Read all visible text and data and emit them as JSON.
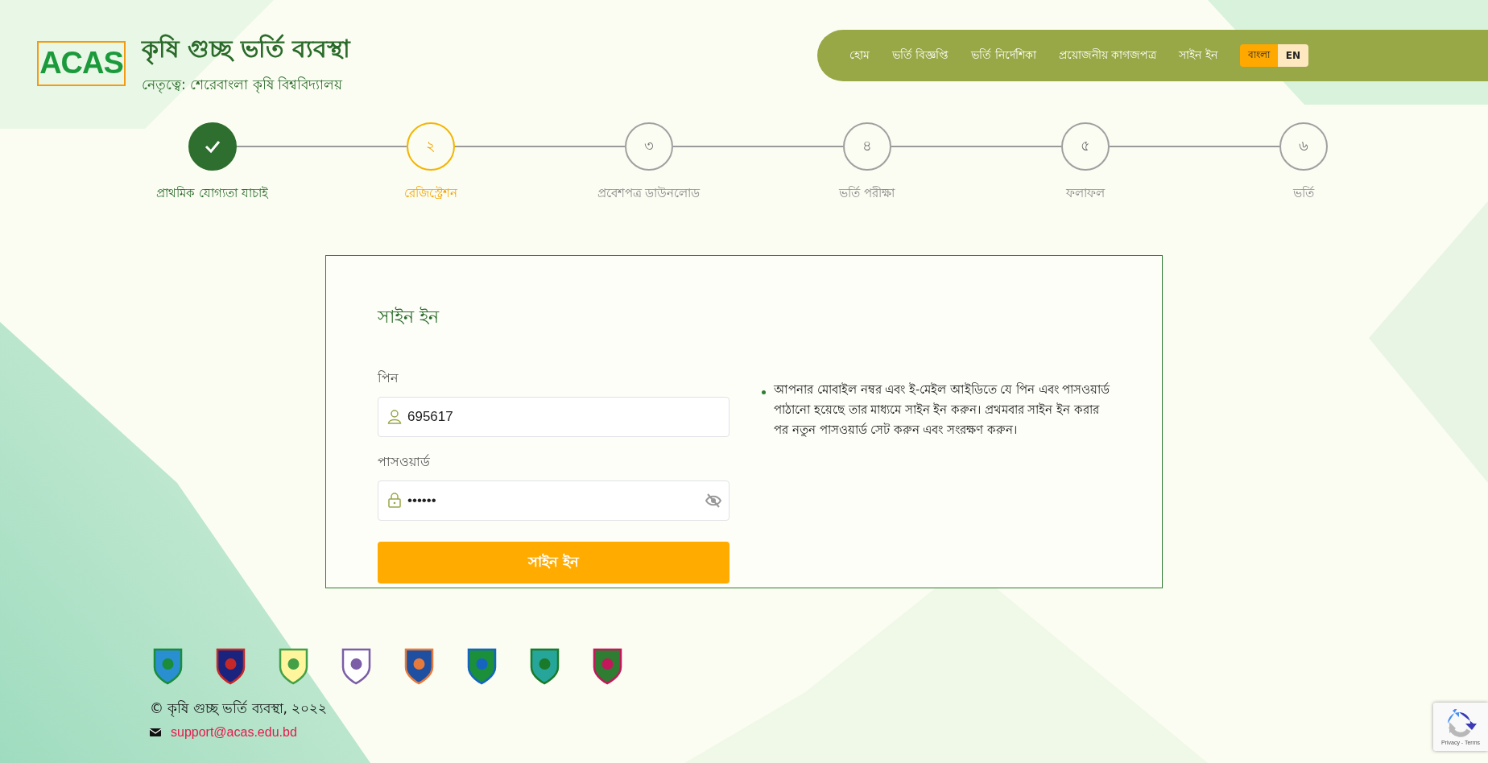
{
  "header": {
    "logo_text": "ACAS",
    "title": "কৃষি গুচ্ছ ভর্তি ব্যবস্থা",
    "subtitle": "নেতৃত্বে: শেরেবাংলা কৃষি বিশ্ববিদ্যালয়"
  },
  "nav": {
    "items": [
      {
        "label": "হোম"
      },
      {
        "label": "ভর্তি বিজ্ঞপ্তি"
      },
      {
        "label": "ভর্তি নির্দেশিকা"
      },
      {
        "label": "প্রয়োজনীয় কাগজপত্র"
      },
      {
        "label": "সাইন ইন"
      }
    ],
    "languages": [
      {
        "label": "বাংলা",
        "selected": true
      },
      {
        "label": "EN",
        "selected": false
      }
    ]
  },
  "steps": [
    {
      "label": "প্রাথমিক যোগ্যতা যাচাই",
      "kind": "done"
    },
    {
      "number": "২",
      "label": "রেজিস্ট্রেশন",
      "kind": "current"
    },
    {
      "number": "৩",
      "label": "প্রবেশপত্র ডাউনলোড",
      "kind": "pending"
    },
    {
      "number": "৪",
      "label": "ভর্তি পরীক্ষা",
      "kind": "pending"
    },
    {
      "number": "৫",
      "label": "ফলাফল",
      "kind": "pending"
    },
    {
      "number": "৬",
      "label": "ভর্তি",
      "kind": "pending"
    }
  ],
  "form": {
    "title": "সাইন ইন",
    "fields": [
      {
        "label": "পিন",
        "value": "695617",
        "kind": "user"
      },
      {
        "label": "পাসওয়ার্ড",
        "value": "••••••",
        "kind": "password"
      }
    ],
    "submit": "সাইন ইন",
    "note": "আপনার মোবাইল নম্বর এবং ই-মেইল আইডিতে যে পিন এবং পাসওয়ার্ড পাঠানো হয়েছে তার মাধ্যমে সাইন ইন করুন। প্রথমবার সাইন ইন করার পর নতুন পাসওয়ার্ড সেট করুন এবং সংরক্ষণ করুন।"
  },
  "footer": {
    "copyright": "© কৃষি গুচ্ছ ভর্তি ব্যবস্থা, ২০২২",
    "email": "support@acas.edu.bd"
  },
  "recaptcha": {
    "links": "Privacy - Terms"
  }
}
